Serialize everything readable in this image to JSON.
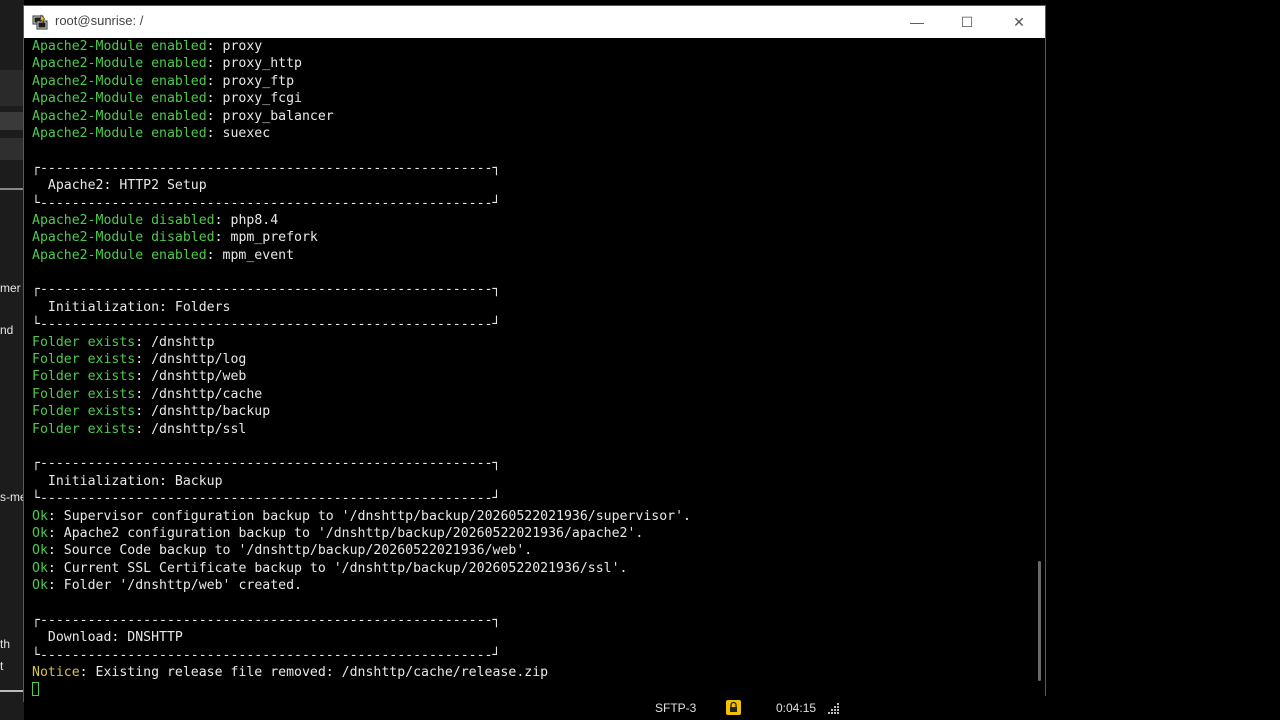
{
  "window": {
    "title": "root@sunrise: /",
    "minimize_glyph": "—",
    "maximize_glyph": "☐",
    "close_glyph": "✕"
  },
  "background_app": {
    "fragments": [
      "mer",
      "nd",
      "s-me",
      "th",
      "t"
    ]
  },
  "terminal": {
    "lines": [
      {
        "g": "Apache2-Module enabled",
        "t": ": proxy"
      },
      {
        "g": "Apache2-Module enabled",
        "t": ": proxy_http"
      },
      {
        "g": "Apache2-Module enabled",
        "t": ": proxy_ftp"
      },
      {
        "g": "Apache2-Module enabled",
        "t": ": proxy_fcgi"
      },
      {
        "g": "Apache2-Module enabled",
        "t": ": proxy_balancer"
      },
      {
        "g": "Apache2-Module enabled",
        "t": ": suexec"
      },
      {
        "t": ""
      },
      {
        "t": "┌---------------------------------------------------------┐"
      },
      {
        "t": "  Apache2: HTTP2 Setup"
      },
      {
        "t": "└---------------------------------------------------------┘"
      },
      {
        "g": "Apache2-Module disabled",
        "t": ": php8.4"
      },
      {
        "g": "Apache2-Module disabled",
        "t": ": mpm_prefork"
      },
      {
        "g": "Apache2-Module enabled",
        "t": ": mpm_event"
      },
      {
        "t": ""
      },
      {
        "t": "┌---------------------------------------------------------┐"
      },
      {
        "t": "  Initialization: Folders"
      },
      {
        "t": "└---------------------------------------------------------┘"
      },
      {
        "g": "Folder exists",
        "t": ": /dnshttp"
      },
      {
        "g": "Folder exists",
        "t": ": /dnshttp/log"
      },
      {
        "g": "Folder exists",
        "t": ": /dnshttp/web"
      },
      {
        "g": "Folder exists",
        "t": ": /dnshttp/cache"
      },
      {
        "g": "Folder exists",
        "t": ": /dnshttp/backup"
      },
      {
        "g": "Folder exists",
        "t": ": /dnshttp/ssl"
      },
      {
        "t": ""
      },
      {
        "t": "┌---------------------------------------------------------┐"
      },
      {
        "t": "  Initialization: Backup"
      },
      {
        "t": "└---------------------------------------------------------┘"
      },
      {
        "g": "Ok",
        "t": ": Supervisor configuration backup to '/dnshttp/backup/20260522021936/supervisor'."
      },
      {
        "g": "Ok",
        "t": ": Apache2 configuration backup to '/dnshttp/backup/20260522021936/apache2'."
      },
      {
        "g": "Ok",
        "t": ": Source Code backup to '/dnshttp/backup/20260522021936/web'."
      },
      {
        "g": "Ok",
        "t": ": Current SSL Certificate backup to '/dnshttp/backup/20260522021936/ssl'."
      },
      {
        "g": "Ok",
        "t": ": Folder '/dnshttp/web' created."
      },
      {
        "t": ""
      },
      {
        "t": "┌---------------------------------------------------------┐"
      },
      {
        "t": "  Download: DNSHTTP"
      },
      {
        "t": "└---------------------------------------------------------┘"
      },
      {
        "y": "Notice",
        "t": ": Existing release file removed: /dnshttp/cache/release.zip"
      }
    ]
  },
  "statusbar": {
    "session": "SFTP-3",
    "timer": "0:04:15"
  },
  "colors": {
    "green": "#4ec94e",
    "yellow": "#d8c24a"
  }
}
